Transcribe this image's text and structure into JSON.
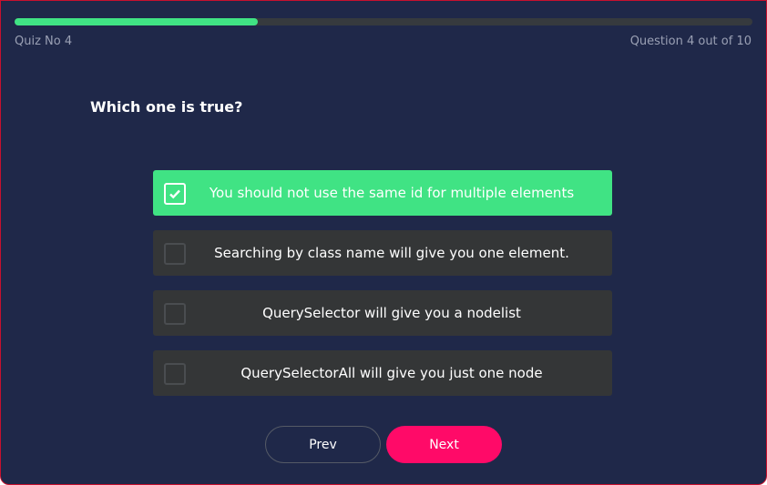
{
  "progress": {
    "percent": 33,
    "color": "#40e384"
  },
  "quiz_label": "Quiz No 4",
  "question_counter": "Question 4 out of 10",
  "question": "Which one is true?",
  "options": [
    {
      "label": "You should not use the same id for multiple elements",
      "checked": true
    },
    {
      "label": "Searching by class name will give you one element.",
      "checked": false
    },
    {
      "label": "QuerySelector will give you a nodelist",
      "checked": false
    },
    {
      "label": "QuerySelectorAll will give you just one node",
      "checked": false
    }
  ],
  "buttons": {
    "prev": "Prev",
    "next": "Next"
  },
  "colors": {
    "background": "#1f2849",
    "selected": "#40e384",
    "option": "#343637",
    "next": "#ff0a68"
  }
}
